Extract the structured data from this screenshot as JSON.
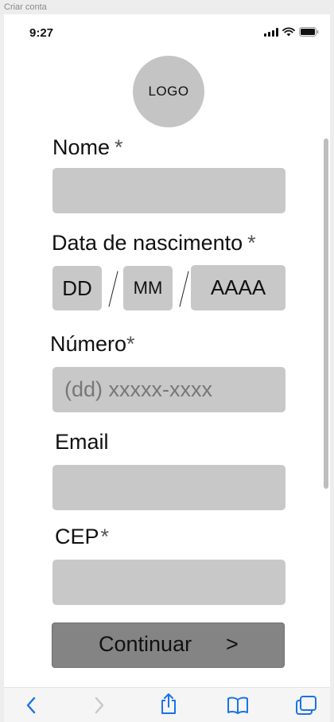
{
  "window": {
    "title": "Criar conta"
  },
  "status_bar": {
    "time": "9:27"
  },
  "logo": {
    "text": "LOGO"
  },
  "form": {
    "nome": {
      "label": "Nome",
      "required_mark": "*",
      "value": ""
    },
    "data_nascimento": {
      "label": "Data de nascimento",
      "required_mark": "*",
      "day_placeholder": "DD",
      "month_placeholder": "MM",
      "year_placeholder": "AAAA",
      "separator": "/"
    },
    "numero": {
      "label": "Número",
      "required_mark": "*",
      "placeholder": "(dd) xxxxx-xxxx"
    },
    "email": {
      "label": "Email",
      "value": ""
    },
    "cep": {
      "label": "CEP",
      "required_mark": "*",
      "value": ""
    }
  },
  "continue_button": {
    "label": "Continuar",
    "arrow": ">"
  },
  "toolbar": {
    "icons": [
      "back-icon",
      "forward-icon",
      "share-icon",
      "bookmarks-icon",
      "tabs-icon"
    ],
    "accent": "#1a73e8",
    "disabled": "#c7c7cc"
  }
}
